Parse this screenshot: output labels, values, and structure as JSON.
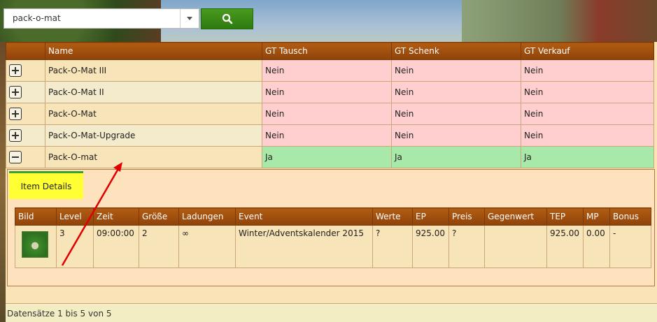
{
  "search": {
    "value": "pack-o-mat"
  },
  "table": {
    "headers": [
      "Name",
      "GT Tausch",
      "GT Schenk",
      "GT Verkauf"
    ],
    "rows": [
      {
        "name": "Pack-O-Mat III",
        "tausch": "Nein",
        "schenk": "Nein",
        "verkauf": "Nein",
        "expanded": false
      },
      {
        "name": "Pack-O-Mat II",
        "tausch": "Nein",
        "schenk": "Nein",
        "verkauf": "Nein",
        "expanded": false
      },
      {
        "name": "Pack-O-Mat",
        "tausch": "Nein",
        "schenk": "Nein",
        "verkauf": "Nein",
        "expanded": false
      },
      {
        "name": "Pack-O-Mat-Upgrade",
        "tausch": "Nein",
        "schenk": "Nein",
        "verkauf": "Nein",
        "expanded": false
      },
      {
        "name": "Pack-O-mat",
        "tausch": "Ja",
        "schenk": "Ja",
        "verkauf": "Ja",
        "expanded": true
      }
    ]
  },
  "details": {
    "tab_label": "Item Details",
    "headers": [
      "Bild",
      "Level",
      "Zeit",
      "Größe",
      "Ladungen",
      "Event",
      "Werte",
      "EP",
      "Preis",
      "Gegenwert",
      "TEP",
      "MP",
      "Bonus"
    ],
    "row": {
      "level": "3",
      "zeit": "09:00:00",
      "groesse": "2",
      "ladungen": "∞",
      "event": "Winter/Adventskalender 2015",
      "werte": "?",
      "ep": "925.00",
      "preis": "?",
      "gegenwert": "",
      "tep": "925.00",
      "mp": "0.00",
      "bonus": "-"
    }
  },
  "footer": {
    "text": "Datensätze 1 bis 5 von 5"
  },
  "colors": {
    "no": "#ffcfcf",
    "yes": "#a8e8a8",
    "header": "#a14e0e",
    "search_button": "#3a8a18",
    "tab": "#ffff33",
    "annotation_arrow": "#e00000"
  },
  "icons": {
    "search": "search-icon",
    "dropdown": "chevron-down-icon",
    "expand": "plus-icon",
    "collapse": "minus-icon"
  }
}
